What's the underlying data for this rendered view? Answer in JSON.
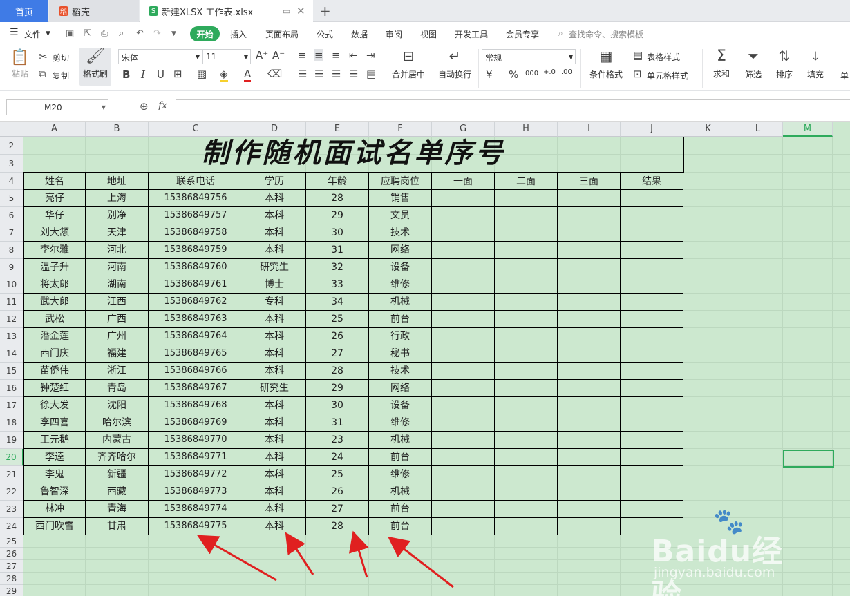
{
  "tabs": {
    "home": "首页",
    "docer": "稻壳",
    "file": "新建XLSX 工作表.xlsx",
    "add": "+"
  },
  "menu": {
    "file": "文件",
    "items": [
      "开始",
      "插入",
      "页面布局",
      "公式",
      "数据",
      "审阅",
      "视图",
      "开发工具",
      "会员专享"
    ],
    "search": "查找命令、搜索模板"
  },
  "ribbon": {
    "paste": "粘贴",
    "cut": "剪切",
    "copy": "复制",
    "format_painter": "格式刷",
    "font_name": "宋体",
    "font_size": "11",
    "merge_center": "合并居中",
    "wrap_text": "自动换行",
    "number_format": "常规",
    "cond_format": "条件格式",
    "table_style": "表格样式",
    "cell_style": "单元格样式",
    "sum": "求和",
    "filter": "筛选",
    "sort": "排序",
    "fill": "填充",
    "more": "单"
  },
  "formula_bar": {
    "name_box": "M20",
    "fx": "fx",
    "value": ""
  },
  "sheet": {
    "columns": [
      "A",
      "B",
      "C",
      "D",
      "E",
      "F",
      "G",
      "H",
      "I",
      "J",
      "K",
      "L",
      "M"
    ],
    "title": "制作随机面试名单序号",
    "headers": [
      "姓名",
      "地址",
      "联系电话",
      "学历",
      "年龄",
      "应聘岗位",
      "一面",
      "二面",
      "三面",
      "结果"
    ],
    "rows": [
      [
        "亮仔",
        "上海",
        "15386849756",
        "本科",
        "28",
        "销售"
      ],
      [
        "华仔",
        "别净",
        "15386849757",
        "本科",
        "29",
        "文员"
      ],
      [
        "刘大颔",
        "天津",
        "15386849758",
        "本科",
        "30",
        "技术"
      ],
      [
        "李尔雅",
        "河北",
        "15386849759",
        "本科",
        "31",
        "网络"
      ],
      [
        "温子升",
        "河南",
        "15386849760",
        "研究生",
        "32",
        "设备"
      ],
      [
        "将太郎",
        "湖南",
        "15386849761",
        "博士",
        "33",
        "维修"
      ],
      [
        "武大郎",
        "江西",
        "15386849762",
        "专科",
        "34",
        "机械"
      ],
      [
        "武松",
        "广西",
        "15386849763",
        "本科",
        "25",
        "前台"
      ],
      [
        "潘金莲",
        "广州",
        "15386849764",
        "本科",
        "26",
        "行政"
      ],
      [
        "西门庆",
        "福建",
        "15386849765",
        "本科",
        "27",
        "秘书"
      ],
      [
        "苗侨伟",
        "浙江",
        "15386849766",
        "本科",
        "28",
        "技术"
      ],
      [
        "钟楚红",
        "青岛",
        "15386849767",
        "研究生",
        "29",
        "网络"
      ],
      [
        "徐大发",
        "沈阳",
        "15386849768",
        "本科",
        "30",
        "设备"
      ],
      [
        "李四喜",
        "哈尔滨",
        "15386849769",
        "本科",
        "31",
        "维修"
      ],
      [
        "王元鹅",
        "内蒙古",
        "15386849770",
        "本科",
        "23",
        "机械"
      ],
      [
        "李逵",
        "齐齐哈尔",
        "15386849771",
        "本科",
        "24",
        "前台"
      ],
      [
        "李鬼",
        "新疆",
        "15386849772",
        "本科",
        "25",
        "维修"
      ],
      [
        "鲁智深",
        "西藏",
        "15386849773",
        "本科",
        "26",
        "机械"
      ],
      [
        "林冲",
        "青海",
        "15386849774",
        "本科",
        "27",
        "前台"
      ],
      [
        "西门吹雪",
        "甘肃",
        "15386849775",
        "本科",
        "28",
        "前台"
      ]
    ],
    "row_numbers": [
      "2",
      "3",
      "4",
      "5",
      "6",
      "7",
      "8",
      "9",
      "10",
      "11",
      "12",
      "13",
      "14",
      "15",
      "16",
      "17",
      "18",
      "19",
      "20",
      "21",
      "22",
      "23",
      "24",
      "25",
      "26",
      "27",
      "28",
      "29"
    ],
    "selected_cell": "M20"
  },
  "watermark": {
    "brand": "Baidu经验",
    "url": "jingyan.baidu.com"
  },
  "colors": {
    "accent": "#2eaa5c",
    "home_tab": "#3f7be6",
    "sheet_bg": "#cce8cf",
    "arrow": "#e02020"
  }
}
